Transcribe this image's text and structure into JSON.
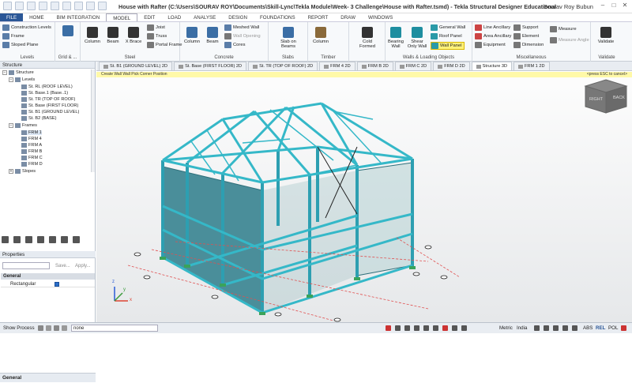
{
  "title_bar": {
    "title": "House with Rafter (C:\\Users\\SOURAV ROY\\Documents\\Skill-Lync\\Tekla Module\\Week- 3 Challenge\\House with Rafter.tsmd) - Tekla Structural Designer Educational",
    "user": "Sourav Roy Bubun"
  },
  "menu": [
    "FILE",
    "HOME",
    "BIM INTEGRATION",
    "MODEL",
    "EDIT",
    "LOAD",
    "ANALYSE",
    "DESIGN",
    "FOUNDATIONS",
    "REPORT",
    "DRAW",
    "WINDOWS"
  ],
  "ribbon": {
    "levels": {
      "items": [
        "Construction Levels",
        "Frame",
        "Sloped Plane"
      ],
      "label": "Levels"
    },
    "grid": {
      "label": "Grid & ..."
    },
    "steel": {
      "buttons": [
        "Column",
        "Beam",
        "X Brace"
      ],
      "items": [
        "Joist",
        "Truss",
        "Portal Frame"
      ],
      "label": "Steel"
    },
    "concrete": {
      "buttons": [
        "Column",
        "Beam"
      ],
      "items": [
        "Meshed Wall",
        "Wall Opening",
        "Cores"
      ],
      "label": "Concrete"
    },
    "slabs": {
      "buttons": [
        "Slab on Beams"
      ],
      "label": "Slabs"
    },
    "timber": {
      "buttons": [
        "Column"
      ],
      "label": "Timber"
    },
    "cold": {
      "buttons": [
        "Cold Formed"
      ]
    },
    "walls": {
      "buttons": [
        "Bearing Wall",
        "Shear Only Wall"
      ],
      "items": [
        "General Wall",
        "Roof Panel",
        "Wall Panel"
      ],
      "label": "Walls & Loading Objects"
    },
    "misc": {
      "items": [
        "Line Ancillary",
        "Area Ancillary",
        "Equipment",
        "Support",
        "Element",
        "Dimension",
        "Measure",
        "Measure Angle"
      ],
      "label": "Miscellaneous"
    },
    "validate": {
      "button": "Validate",
      "label": "Validate"
    }
  },
  "structure_panel": {
    "title": "Structure",
    "root": "Structure",
    "levels_label": "Levels",
    "levels": [
      "St. RL (ROOF LEVEL)",
      "St. Base.1 (Base..1)",
      "St. TR (TOP OF ROOF)",
      "St. Base (FIRST FLOOR)",
      "St. B1 (GROUND LEVEL)",
      "St. B2 (BASE)"
    ],
    "frames_label": "Frames",
    "frames": [
      "FRM 1",
      "FRM 4",
      "FRM A",
      "FRM B",
      "FRM C",
      "FRM D"
    ],
    "slopes_label": "Slopes"
  },
  "properties": {
    "title": "Properties",
    "save": "Save...",
    "apply": "Apply...",
    "section": "General",
    "row": "Rectangular",
    "bottom": "General"
  },
  "tabs": [
    "St. B1 (GROUND LEVEL) 2D",
    "St. Base (FIRST FLOOR) 2D",
    "St. TR (TOP OF ROOF) 2D",
    "FRM 4 2D",
    "FRM B 2D",
    "FRM C 2D",
    "FRM D 2D",
    "Structure 3D",
    "FRM 1 2D"
  ],
  "hint": {
    "left": "Create Wall Wall  Pick Corner Position",
    "right": "<press ESC to cancel>"
  },
  "view_cube": {
    "left": "RIGHT",
    "right": "BACK"
  },
  "axes": {
    "x": "x",
    "y": "y",
    "z": "z"
  },
  "status": {
    "show_process": "Show Process",
    "combo": "none",
    "units": "Metric",
    "region": "India",
    "modes": [
      "ABS",
      "REL",
      "POL"
    ]
  },
  "colors": {
    "member": "#35b8c8",
    "wall": "#4a8e9a",
    "accent": "#2b5797"
  }
}
